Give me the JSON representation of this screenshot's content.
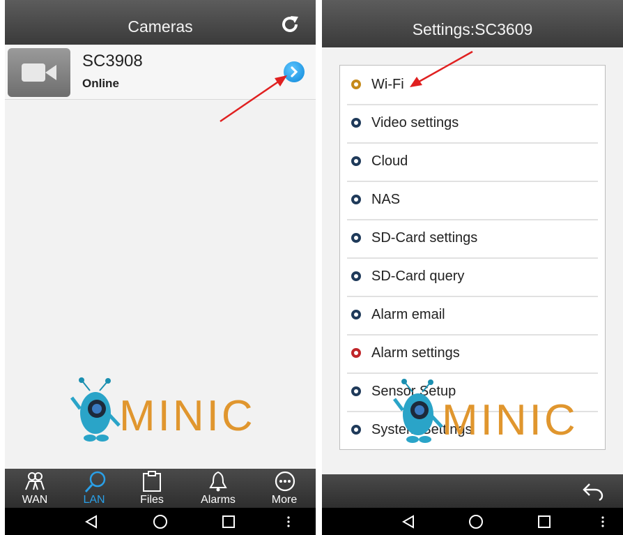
{
  "left_screen": {
    "title": "Cameras",
    "camera": {
      "name": "SC3908",
      "status": "Online"
    },
    "tabs": [
      {
        "label": "WAN",
        "icon": "users-icon"
      },
      {
        "label": "LAN",
        "icon": "search-icon"
      },
      {
        "label": "Files",
        "icon": "clipboard-icon"
      },
      {
        "label": "Alarms",
        "icon": "bell-icon"
      },
      {
        "label": "More",
        "icon": "more-icon"
      }
    ]
  },
  "right_screen": {
    "title": "Settings:SC3609",
    "items": [
      {
        "label": "Wi-Fi",
        "color": "#c58a1a"
      },
      {
        "label": "Video settings",
        "color": "#1f3a5a"
      },
      {
        "label": "Cloud",
        "color": "#1f3a5a"
      },
      {
        "label": "NAS",
        "color": "#1f3a5a"
      },
      {
        "label": "SD-Card settings",
        "color": "#1f3a5a"
      },
      {
        "label": "SD-Card query",
        "color": "#1f3a5a"
      },
      {
        "label": "Alarm email",
        "color": "#1f3a5a"
      },
      {
        "label": "Alarm settings",
        "color": "#c0262a"
      },
      {
        "label": "Sensor Setup",
        "color": "#1f3a5a"
      },
      {
        "label": "System Settings",
        "color": "#1f3a5a"
      }
    ]
  },
  "watermark": {
    "text": "MINIC",
    "color": "#e0962e"
  },
  "colors": {
    "accent": "#2aa0e8",
    "arrow": "#e02020"
  }
}
